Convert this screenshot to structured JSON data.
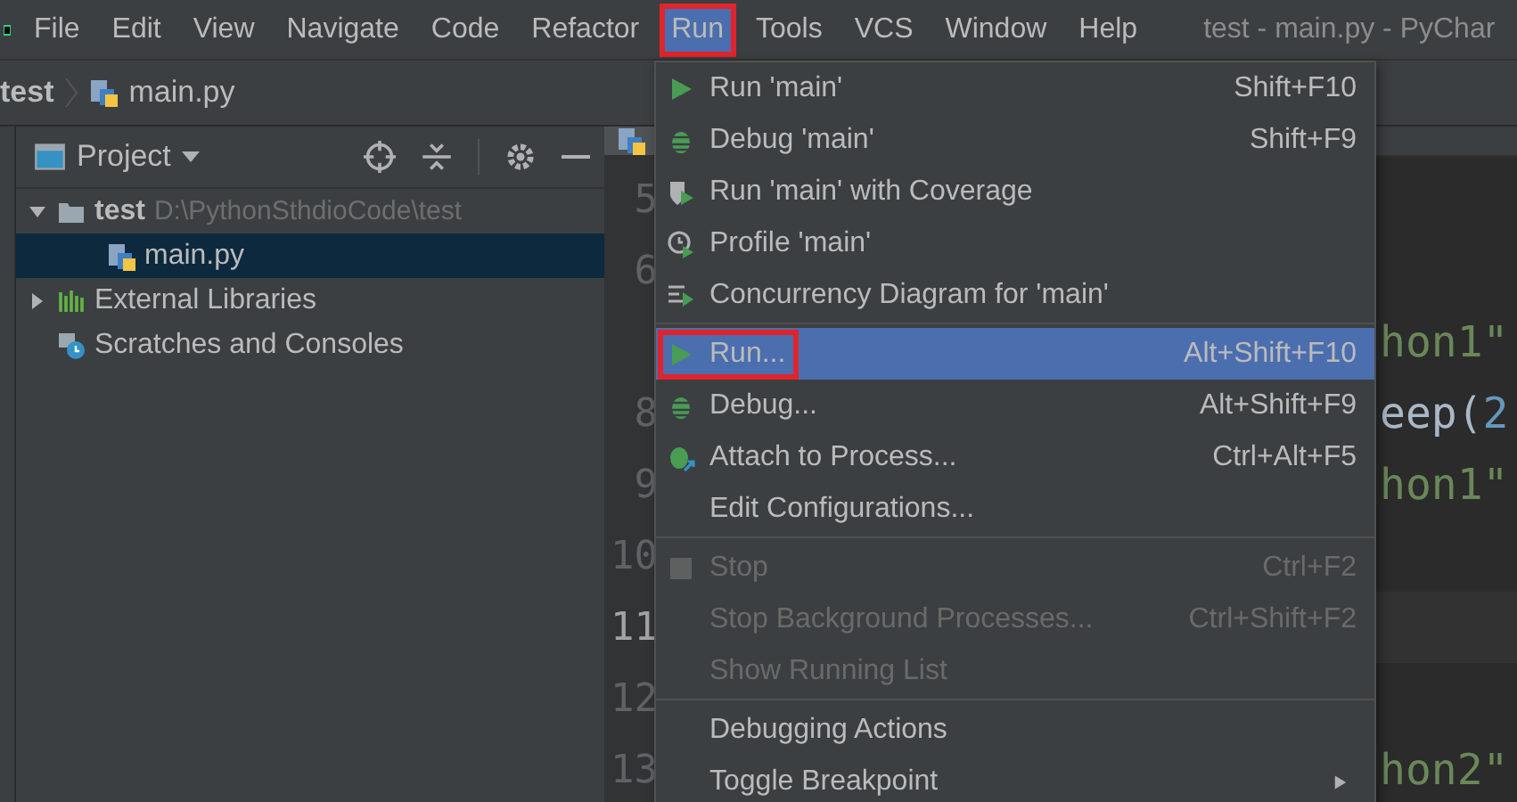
{
  "menu_bar": {
    "items": [
      {
        "label": "File",
        "selected": false
      },
      {
        "label": "Edit",
        "selected": false
      },
      {
        "label": "View",
        "selected": false
      },
      {
        "label": "Navigate",
        "selected": false
      },
      {
        "label": "Code",
        "selected": false
      },
      {
        "label": "Refactor",
        "selected": false
      },
      {
        "label": "Run",
        "selected": true,
        "highlighted": true
      },
      {
        "label": "Tools",
        "selected": false
      },
      {
        "label": "VCS",
        "selected": false
      },
      {
        "label": "Window",
        "selected": false
      },
      {
        "label": "Help",
        "selected": false
      }
    ],
    "title": "test - main.py - PyChar"
  },
  "breadcrumb": [
    "test",
    "main.py"
  ],
  "project_panel": {
    "title": "Project",
    "tree": [
      {
        "label": "test",
        "path": "D:\\PythonSthdioCode\\test",
        "kind": "folder",
        "expanded": true,
        "selected": false,
        "children": [
          {
            "label": "main.py",
            "kind": "python",
            "selected": true
          }
        ]
      },
      {
        "label": "External Libraries",
        "kind": "libraries",
        "expanded": false,
        "selected": false
      },
      {
        "label": "Scratches and Consoles",
        "kind": "scratches",
        "selected": false
      }
    ]
  },
  "editor": {
    "lines": [
      {
        "number": "5"
      },
      {
        "number": "6"
      },
      {
        "code": [
          {
            "text": "hon1\"",
            "kind": "string"
          }
        ]
      },
      {
        "number": "8",
        "code": [
          {
            "text": "eep(",
            "kind": "plain"
          },
          {
            "text": "2",
            "kind": "number"
          }
        ]
      },
      {
        "number": "9",
        "code": [
          {
            "text": "hon1\"",
            "kind": "string"
          }
        ]
      },
      {
        "number": "10"
      },
      {
        "number": "11",
        "current": true
      },
      {
        "number": "12"
      },
      {
        "number": "13",
        "code": [
          {
            "text": "hon2\"",
            "kind": "string"
          }
        ]
      }
    ]
  },
  "run_menu": {
    "items": [
      {
        "kind": "item",
        "label": "Run 'main'",
        "shortcut": "Shift+F10",
        "selected": false,
        "disabled": false
      },
      {
        "kind": "item",
        "label": "Debug 'main'",
        "shortcut": "Shift+F9",
        "selected": false,
        "disabled": false
      },
      {
        "kind": "item",
        "label": "Run 'main' with Coverage",
        "selected": false,
        "disabled": false
      },
      {
        "kind": "item",
        "label": "Profile 'main'",
        "selected": false,
        "disabled": false
      },
      {
        "kind": "item",
        "label": "Concurrency Diagram for 'main'",
        "selected": false,
        "disabled": false
      },
      {
        "kind": "separator"
      },
      {
        "kind": "item",
        "label": "Run...",
        "shortcut": "Alt+Shift+F10",
        "selected": true,
        "highlighted": true,
        "disabled": false
      },
      {
        "kind": "item",
        "label": "Debug...",
        "shortcut": "Alt+Shift+F9",
        "selected": false,
        "disabled": false
      },
      {
        "kind": "item",
        "label": "Attach to Process...",
        "shortcut": "Ctrl+Alt+F5",
        "selected": false,
        "disabled": false
      },
      {
        "kind": "item",
        "label": "Edit Configurations...",
        "selected": false,
        "disabled": false
      },
      {
        "kind": "separator"
      },
      {
        "kind": "item",
        "label": "Stop",
        "shortcut": "Ctrl+F2",
        "selected": false,
        "disabled": true
      },
      {
        "kind": "item",
        "label": "Stop Background Processes...",
        "shortcut": "Ctrl+Shift+F2",
        "selected": false,
        "disabled": true
      },
      {
        "kind": "item",
        "label": "Show Running List",
        "selected": false,
        "disabled": true
      },
      {
        "kind": "separator"
      },
      {
        "kind": "item",
        "label": "Debugging Actions",
        "selected": false,
        "disabled": false
      },
      {
        "kind": "item",
        "label": "Toggle Breakpoint",
        "submenu": true,
        "selected": false,
        "disabled": false
      }
    ]
  }
}
